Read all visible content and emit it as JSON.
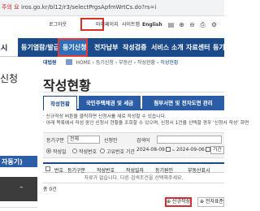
{
  "browser": {
    "chip": "주의 요함",
    "url": "iros.go.kr/bl12/r3/selectPrgsApfmWrtCs.do?rs=i"
  },
  "utility": {
    "items": [
      "로그아웃",
      "마이페이지",
      "사이트맵",
      "English"
    ]
  },
  "nav": {
    "left": "시",
    "items": [
      "등기열람/발급",
      "등기신청",
      "전자납부",
      "작성검증",
      "서비스 소개",
      "자료센터",
      "등기"
    ],
    "active_index": 1
  },
  "sidebar": {
    "title": "신청",
    "band": "자동기)",
    "block_symbol": "–"
  },
  "breadcrumb": {
    "logo": "대법원",
    "home": "HOME",
    "items": [
      "등기신청",
      "부동산",
      "작성현황",
      "작성현황"
    ]
  },
  "page": {
    "title": "작성현황"
  },
  "tabs": [
    "작성현황",
    "국민주택채권 및 세금",
    "첨부서면 및 전자도면 관리"
  ],
  "notes": [
    "· 신규작성 버튼을 클릭하면 신청서를 새로 작성할 수 있습니다.",
    "· 아래 목록에서 작성 중인 신청서 현황을 조회할 수 있으며, 신청서 1건을 선택할 경우 '신청서 작성' 화면"
  ],
  "filter": {
    "type_label": "등기구분",
    "type_value": "전체",
    "apply_label": "신청인",
    "search_label": "검색어",
    "radio_labels": [
      "작성일",
      "작성번호",
      "고유번호"
    ],
    "date_label": "기간",
    "date_from": "2024-08-09",
    "date_to": "2024-09-06",
    "period_label": "기간 선택"
  },
  "table": {
    "headers": [
      "",
      "번호",
      "등기구분",
      "작성번호",
      "작성일자",
      "등기원인",
      "부동산표시"
    ],
    "empty_text": "자료가 없습니다. 다른 검색조건을 선택해주세요.",
    "count": "총 0건"
  },
  "buttons": {
    "new": "⊕ 신규작성",
    "all": "⊕ 전자표준"
  }
}
